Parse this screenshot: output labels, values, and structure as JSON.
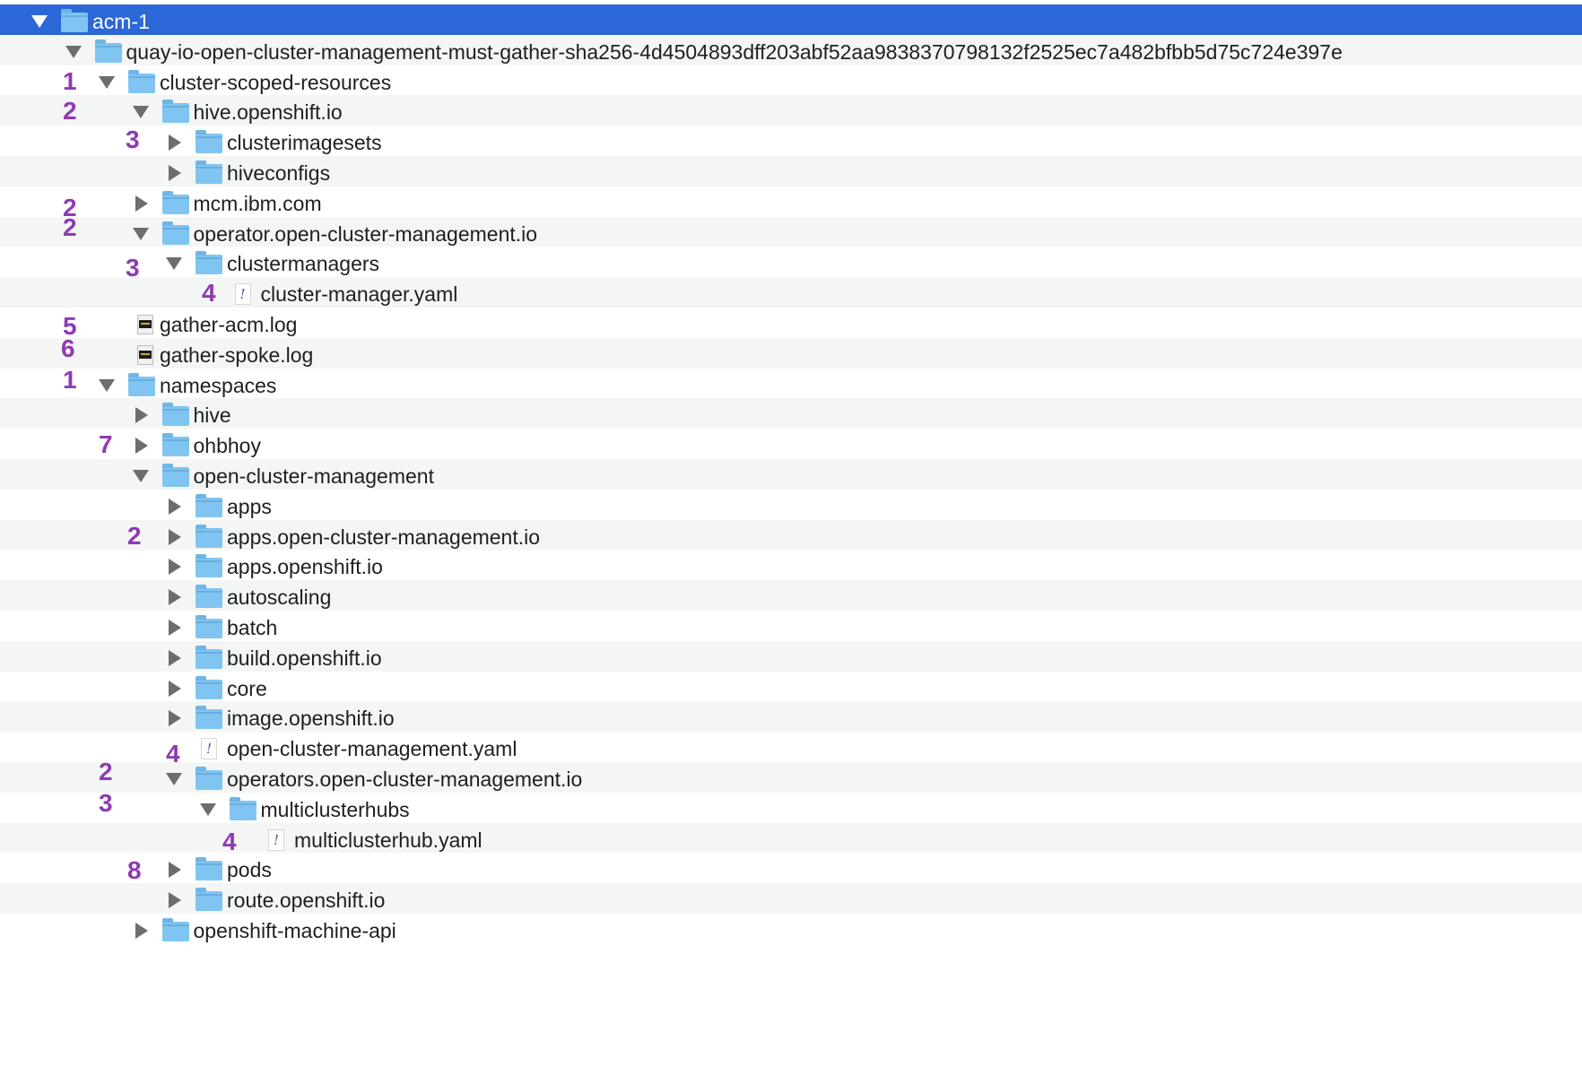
{
  "rows": [
    {
      "label": "acm-1",
      "depth": 0,
      "expander": "down",
      "icon": "folder"
    },
    {
      "label": "quay-io-open-cluster-management-must-gather-sha256-4d4504893dff203abf52aa9838370798132f2525ec7a482bfbb5d75c724e397e",
      "depth": 1,
      "expander": "down",
      "icon": "folder"
    },
    {
      "label": "cluster-scoped-resources",
      "depth": 2,
      "expander": "down",
      "icon": "folder"
    },
    {
      "label": "hive.openshift.io",
      "depth": 3,
      "expander": "down",
      "icon": "folder"
    },
    {
      "label": "clusterimagesets",
      "depth": 4,
      "expander": "right",
      "icon": "folder"
    },
    {
      "label": "hiveconfigs",
      "depth": 4,
      "expander": "right",
      "icon": "folder"
    },
    {
      "label": "mcm.ibm.com",
      "depth": 3,
      "expander": "right",
      "icon": "folder"
    },
    {
      "label": "operator.open-cluster-management.io",
      "depth": 3,
      "expander": "down",
      "icon": "folder"
    },
    {
      "label": "clustermanagers",
      "depth": 4,
      "expander": "down",
      "icon": "folder"
    },
    {
      "label": "cluster-manager.yaml",
      "depth": 5,
      "expander": "none",
      "icon": "yaml-file"
    },
    {
      "label": "gather-acm.log",
      "depth": 2,
      "expander": "none",
      "icon": "log-file"
    },
    {
      "label": "gather-spoke.log",
      "depth": 2,
      "expander": "none",
      "icon": "log-file"
    },
    {
      "label": "namespaces",
      "depth": 2,
      "expander": "down",
      "icon": "folder"
    },
    {
      "label": "hive",
      "depth": 3,
      "expander": "right",
      "icon": "folder"
    },
    {
      "label": "ohbhoy",
      "depth": 3,
      "expander": "right",
      "icon": "folder"
    },
    {
      "label": "open-cluster-management",
      "depth": 3,
      "expander": "down",
      "icon": "folder"
    },
    {
      "label": "apps",
      "depth": 4,
      "expander": "right",
      "icon": "folder"
    },
    {
      "label": "apps.open-cluster-management.io",
      "depth": 4,
      "expander": "right",
      "icon": "folder"
    },
    {
      "label": "apps.openshift.io",
      "depth": 4,
      "expander": "right",
      "icon": "folder"
    },
    {
      "label": "autoscaling",
      "depth": 4,
      "expander": "right",
      "icon": "folder"
    },
    {
      "label": "batch",
      "depth": 4,
      "expander": "right",
      "icon": "folder"
    },
    {
      "label": "build.openshift.io",
      "depth": 4,
      "expander": "right",
      "icon": "folder"
    },
    {
      "label": "core",
      "depth": 4,
      "expander": "right",
      "icon": "folder"
    },
    {
      "label": "image.openshift.io",
      "depth": 4,
      "expander": "right",
      "icon": "folder"
    },
    {
      "label": "open-cluster-management.yaml",
      "depth": 4,
      "expander": "none",
      "icon": "yaml-file"
    },
    {
      "label": "operators.open-cluster-management.io",
      "depth": 4,
      "expander": "down",
      "icon": "folder"
    },
    {
      "label": "multiclusterhubs",
      "depth": 5,
      "expander": "down",
      "icon": "folder"
    },
    {
      "label": "multiclusterhub.yaml",
      "depth": 6,
      "expander": "none",
      "icon": "yaml-file"
    },
    {
      "label": "pods",
      "depth": 4,
      "expander": "right",
      "icon": "folder"
    },
    {
      "label": "route.openshift.io",
      "depth": 4,
      "expander": "right",
      "icon": "folder"
    },
    {
      "label": "openshift-machine-api",
      "depth": 3,
      "expander": "right",
      "icon": "folder"
    }
  ],
  "annotations": [
    {
      "text": "1",
      "row": 2
    },
    {
      "text": "2",
      "row": 3
    },
    {
      "text": "3",
      "row": 4
    },
    {
      "text": "2",
      "row": 6
    },
    {
      "text": "2",
      "row": 7
    },
    {
      "text": "3",
      "row": 8
    },
    {
      "text": "4",
      "row": 9
    },
    {
      "text": "5",
      "row": 10
    },
    {
      "text": "6",
      "row": 11
    },
    {
      "text": "1",
      "row": 12
    },
    {
      "text": "7",
      "row": 14
    },
    {
      "text": "2",
      "row": 17
    },
    {
      "text": "4",
      "row": 24
    },
    {
      "text": "2",
      "row": 25
    },
    {
      "text": "3",
      "row": 26
    },
    {
      "text": "4",
      "row": 27
    },
    {
      "text": "8",
      "row": 28
    }
  ],
  "colors": {
    "selection": "#2b67d6",
    "stripe": "#f4f5f5",
    "folder": "#80c5f1",
    "annotation": "#8e3bb2"
  }
}
